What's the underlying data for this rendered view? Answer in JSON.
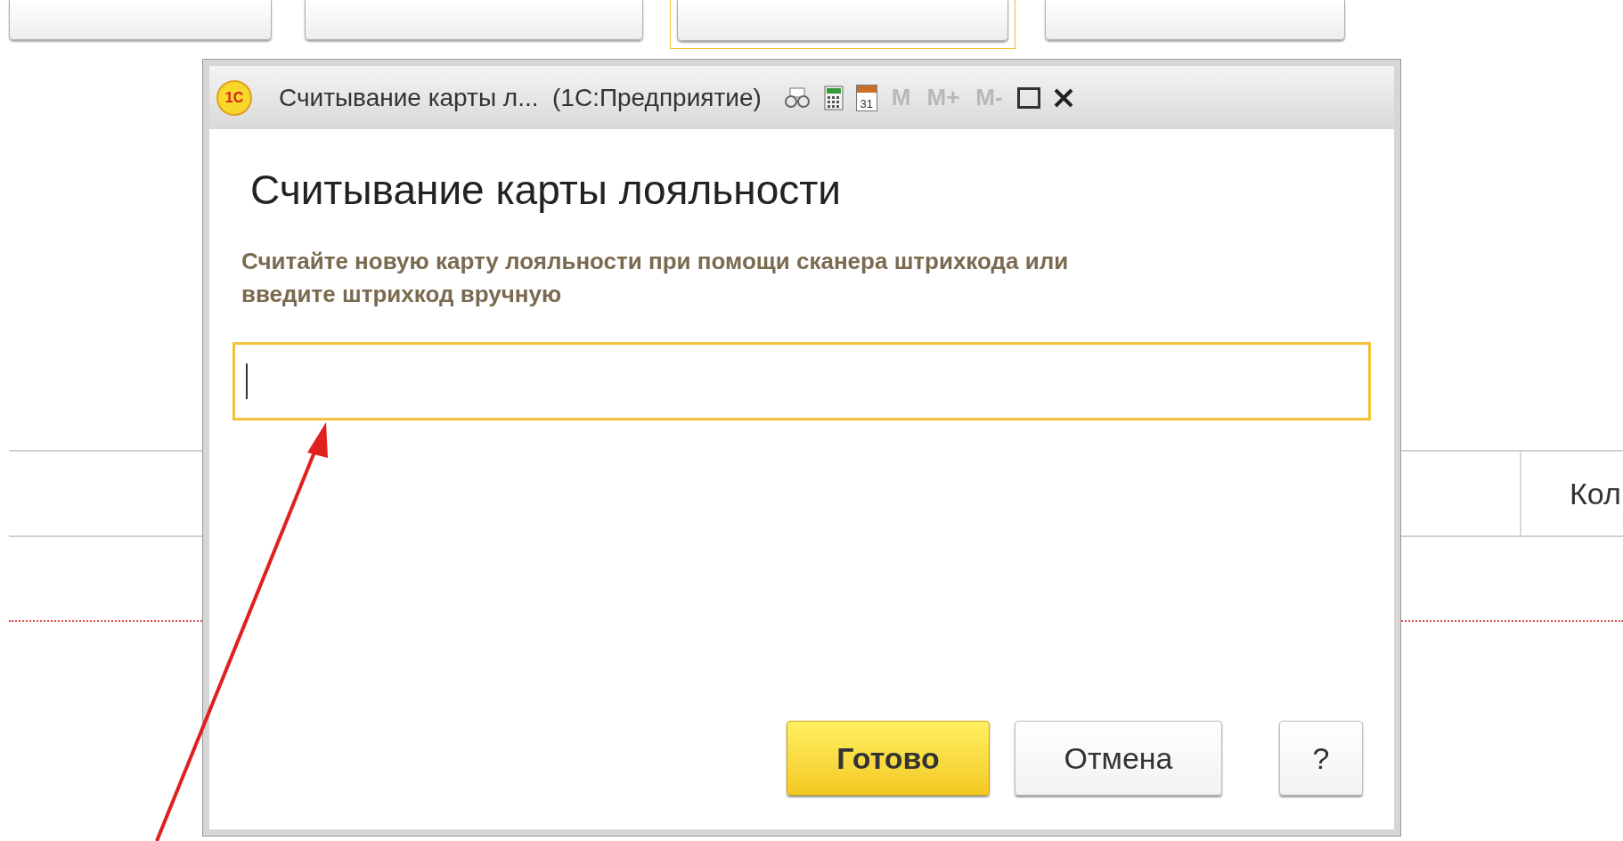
{
  "background": {
    "toolbar_buttons": [
      {
        "focused": false
      },
      {
        "focused": false
      },
      {
        "focused": true
      },
      {
        "focused": false
      }
    ],
    "table": {
      "column_2_header": "Кол"
    }
  },
  "dialog": {
    "logo_text": "1С",
    "title": "Считывание карты л...  (1С:Предприятие)",
    "tools": [
      {
        "kind": "glasses"
      },
      {
        "kind": "calculator"
      },
      {
        "kind": "calendar",
        "text": "31"
      },
      {
        "kind": "memory",
        "text": "M"
      },
      {
        "kind": "memory",
        "text": "M+"
      },
      {
        "kind": "memory",
        "text": "M-"
      },
      {
        "kind": "maximize"
      },
      {
        "kind": "close"
      }
    ],
    "heading": "Считывание карты лояльности",
    "instruction": "Считайте новую карту лояльности при помощи сканера штрихкода или введите штрихкод вручную",
    "barcode_field": {
      "focused": true
    },
    "buttons": [
      {
        "label": "Готово",
        "default": true
      },
      {
        "label": "Отмена",
        "default": false
      },
      {
        "label": "?",
        "default": false
      }
    ]
  },
  "annotation": {
    "kind": "arrow"
  }
}
